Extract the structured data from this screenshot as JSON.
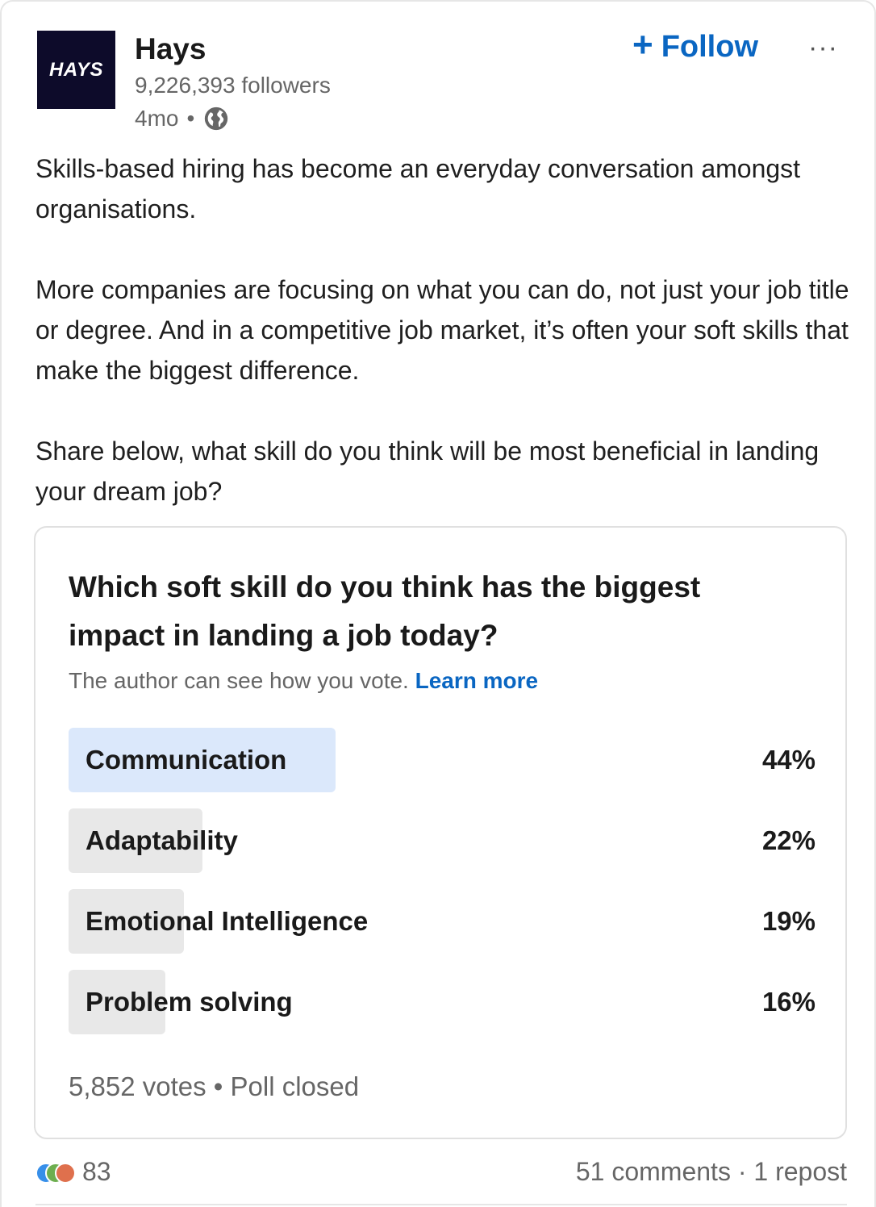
{
  "header": {
    "logo_text": "HAYS",
    "company_name": "Hays",
    "followers": "9,226,393 followers",
    "time": "4mo",
    "separator": "•",
    "follow_label": "Follow",
    "plus_symbol": "+",
    "more_symbol": "···",
    "logo_color": "#0d0b2a",
    "accent_color": "#0a66c2"
  },
  "post": {
    "paragraphs": [
      "Skills-based hiring has become an everyday conversation amongst organisations.",
      "More companies are focusing on what you can do, not just your job title or degree. And in a competitive job market, it’s often your soft skills that make the biggest difference.",
      "Share below, what skill do you think will be most beneficial in landing your dream job?"
    ]
  },
  "poll": {
    "question": "Which soft skill do you think has the biggest impact in landing a job today?",
    "note": "The author can see how you vote.",
    "learn_more": "Learn more",
    "options": [
      {
        "label": "Communication",
        "percent_text": "44%",
        "share": 0.44,
        "winner": true
      },
      {
        "label": "Adaptability",
        "percent_text": "22%",
        "share": 0.22,
        "winner": false
      },
      {
        "label": "Emotional Intelligence",
        "percent_text": "19%",
        "share": 0.19,
        "winner": false
      },
      {
        "label": "Problem solving",
        "percent_text": "16%",
        "share": 0.16,
        "winner": false
      }
    ],
    "votes": "5,852 votes",
    "status": "Poll closed",
    "separator": "•",
    "winner_color": "#dbe8fb",
    "bar_color": "#e8e8e8"
  },
  "social": {
    "reaction_count": "83",
    "reaction_icons": [
      "like-icon",
      "celebrate-icon",
      "love-icon"
    ],
    "comments": "51 comments",
    "separator": "·",
    "reposts": "1 repost"
  }
}
